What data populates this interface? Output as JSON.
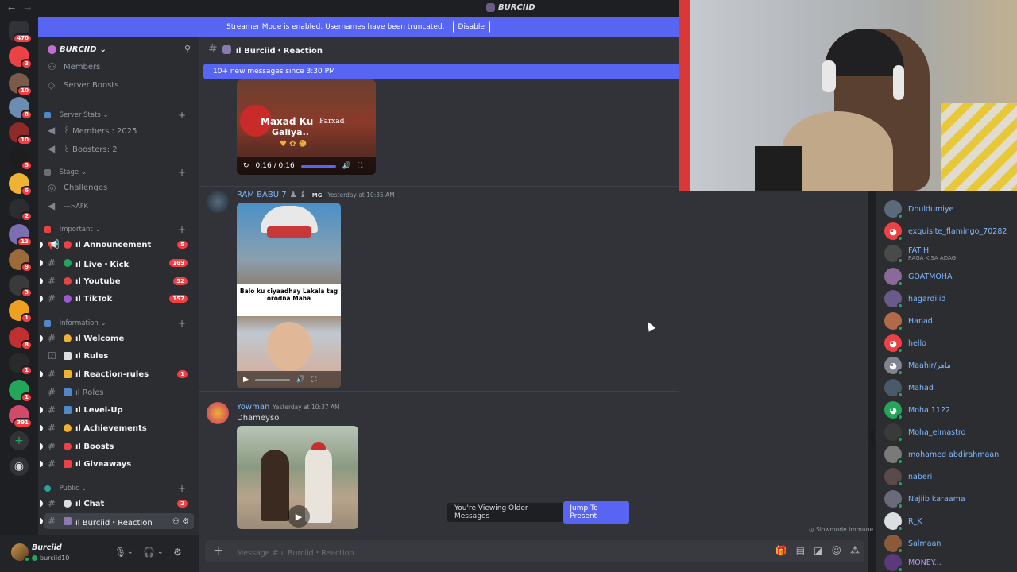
{
  "titlebar": {
    "title": "BURCIID"
  },
  "banner": {
    "text": "Streamer Mode is enabled. Usernames have been truncated.",
    "disable": "Disable"
  },
  "rail": {
    "badges": [
      "470",
      "3",
      "10",
      "8",
      "10",
      "5",
      "6",
      "2",
      "13",
      "9",
      "3",
      "1",
      "8",
      "1",
      "1",
      "391"
    ]
  },
  "guild": {
    "name": "BURCIID"
  },
  "sidebar": {
    "top_items": [
      {
        "label": "Members",
        "icon": "members-icon"
      },
      {
        "label": "Server Boosts",
        "icon": "boost-icon"
      }
    ],
    "categories": {
      "server_stats": "| Server Stats",
      "stage": "| Stage",
      "important": "| Important",
      "information": "| Information",
      "public": "| Public"
    },
    "stats": [
      {
        "label": "꒰ Members : 2025"
      },
      {
        "label": "꒰ Boosters: 2"
      }
    ],
    "stage": [
      {
        "label": "Challenges"
      },
      {
        "label": "--->AFK"
      }
    ],
    "important": [
      {
        "label": "ıl Announcement",
        "count": "5"
      },
      {
        "label": "ıl Live・Kick",
        "count": "169"
      },
      {
        "label": "ıl Youtube",
        "count": "52"
      },
      {
        "label": "ıl TikTok",
        "count": "157"
      }
    ],
    "information": [
      {
        "label": "ıl Welcome"
      },
      {
        "label": "ıl Rules"
      },
      {
        "label": "ıl Reaction-rules",
        "count": "1"
      },
      {
        "label": "ıl Roles"
      },
      {
        "label": "ıl Level-Up"
      },
      {
        "label": "ıl Achievements"
      },
      {
        "label": "ıl Boosts"
      },
      {
        "label": "ıl Giveaways"
      }
    ],
    "public": [
      {
        "label": "ıl Chat",
        "count": "2"
      },
      {
        "label": "ıl Burciid・Reaction"
      }
    ]
  },
  "user": {
    "name": "Burciid",
    "tag": "burciid10"
  },
  "chat": {
    "channel": "ıl Burciid・Reaction",
    "new_messages": "10+ new messages since 3:30 PM",
    "video1": {
      "caption_top": "Maxad Ku",
      "caption_sub": "Farxad",
      "caption_bottom": "Galiya..",
      "time": "0:16 / 0:16"
    },
    "messages": [
      {
        "author": "RAM BABU 7",
        "tag": "MG",
        "time": "Yesterday at 10:35 AM",
        "caption": "Balo ku ciyaadhay Lakala tag orodna Maha"
      },
      {
        "author": "Yowman",
        "time": "Yesterday at 10:37 AM",
        "text": "Dhameyso"
      }
    ],
    "older": "You're Viewing Older Messages",
    "jump": "Jump To Present",
    "slowmode": "Slowmode Immune",
    "composer_placeholder": "Message # ıl Burciid・Reaction"
  },
  "members": [
    {
      "name": "Dhuldumiye"
    },
    {
      "name": "exquisite_flamingo_70282"
    },
    {
      "name": "FATIH",
      "sub": "RAGA KISA ADAG"
    },
    {
      "name": "GOATMOHA"
    },
    {
      "name": "hagardiiid"
    },
    {
      "name": "Hanad"
    },
    {
      "name": "hello"
    },
    {
      "name": "Maahir/ماهر"
    },
    {
      "name": "Mahad"
    },
    {
      "name": "Moha 1122"
    },
    {
      "name": "Moha_elmastro"
    },
    {
      "name": "mohamed abdirahmaan"
    },
    {
      "name": "naberi"
    },
    {
      "name": "Najiib karaama"
    },
    {
      "name": "R_K"
    },
    {
      "name": "Salmaan"
    },
    {
      "name": "MONEY..."
    }
  ],
  "colors": {
    "accent": "#5865f2",
    "badge": "#f23f43",
    "online": "#23a55a",
    "member_name": "#80b8ff"
  }
}
